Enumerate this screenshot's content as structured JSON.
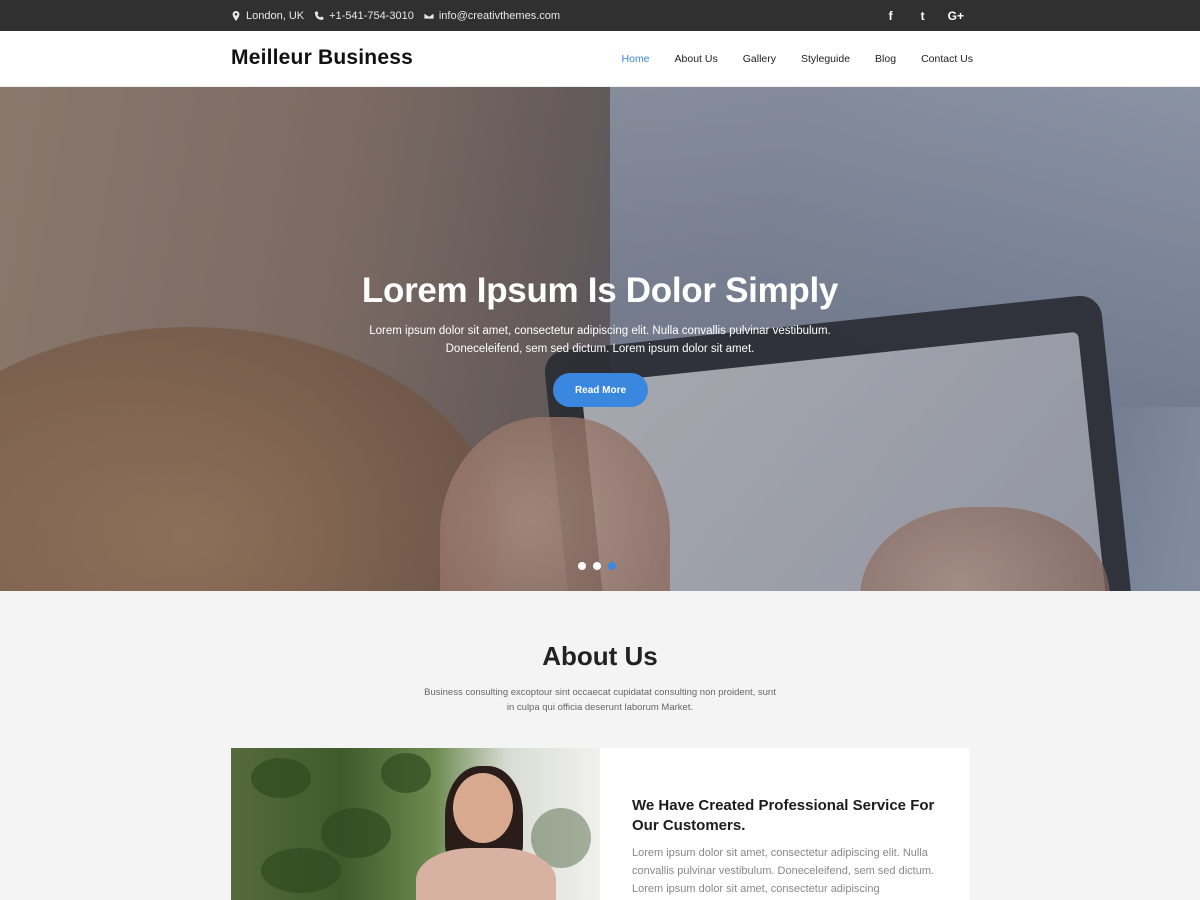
{
  "topbar": {
    "location": "London, UK",
    "phone": "+1-541-754-3010",
    "email": "info@creativthemes.com",
    "social": [
      "f",
      "t",
      "G+"
    ]
  },
  "header": {
    "brand": "Meilleur Business",
    "nav": [
      {
        "label": "Home",
        "active": true
      },
      {
        "label": "About Us",
        "active": false
      },
      {
        "label": "Gallery",
        "active": false
      },
      {
        "label": "Styleguide",
        "active": false
      },
      {
        "label": "Blog",
        "active": false
      },
      {
        "label": "Contact Us",
        "active": false
      }
    ]
  },
  "hero": {
    "title": "Lorem Ipsum Is Dolor Simply",
    "text_line1": "Lorem ipsum dolor sit amet, consectetur adipiscing elit. Nulla convallis pulvinar vestibulum.",
    "text_line2": "Doneceleifend, sem sed dictum. Lorem ipsum dolor sit amet.",
    "button": "Read More",
    "slides_total": 3,
    "active_slide": 3
  },
  "about": {
    "title": "About Us",
    "subtitle_line1": "Business consulting excoptour sint occaecat cupidatat consulting non proident, sunt",
    "subtitle_line2": "in culpa qui officia deserunt laborum Market.",
    "card_title": "We Have Created Professional Service For Our Customers.",
    "card_text": "Lorem ipsum dolor sit amet, consectetur adipiscing elit. Nulla convallis pulvinar vestibulum. Doneceleifend, sem sed dictum. Lorem ipsum dolor sit amet, consectetur adipiscing"
  },
  "colors": {
    "accent": "#3a87e0",
    "topbar": "#303030"
  }
}
